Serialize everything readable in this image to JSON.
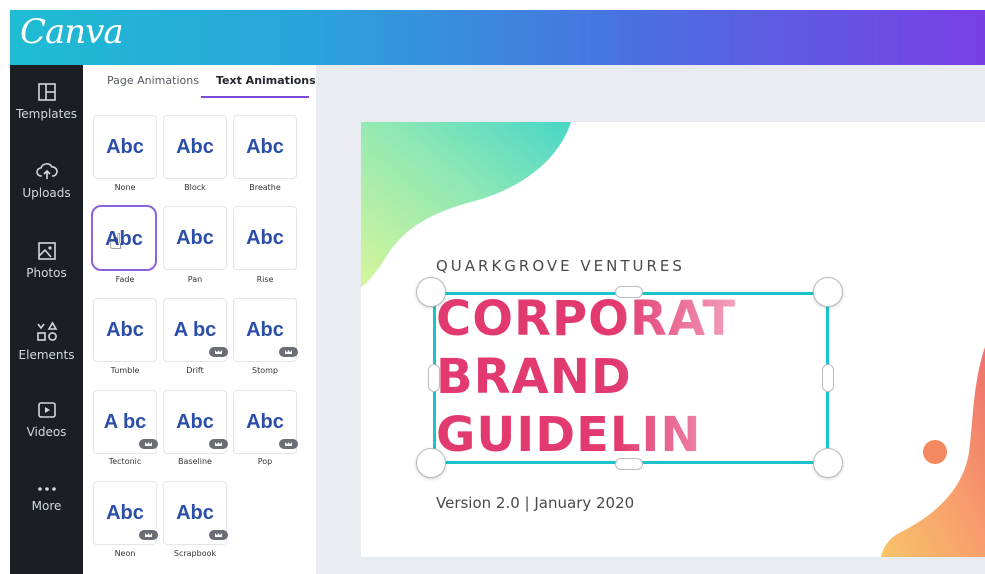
{
  "app": {
    "logo": "Canva"
  },
  "rail": {
    "items": [
      {
        "label": "Templates",
        "icon": "templates-icon"
      },
      {
        "label": "Uploads",
        "icon": "upload-cloud-icon"
      },
      {
        "label": "Photos",
        "icon": "photo-icon"
      },
      {
        "label": "Elements",
        "icon": "shapes-icon"
      },
      {
        "label": "Videos",
        "icon": "video-play-icon"
      },
      {
        "label": "More",
        "icon": "more-dots-icon"
      }
    ]
  },
  "panel": {
    "tabs": [
      {
        "label": "Page Animations",
        "active": false
      },
      {
        "label": "Text Animations",
        "active": true
      }
    ],
    "tiles": [
      {
        "preview": "Abc",
        "name": "None",
        "premium": false,
        "selected": false
      },
      {
        "preview": "Abc",
        "name": "Block",
        "premium": false,
        "selected": false
      },
      {
        "preview": "Abc",
        "name": "Breathe",
        "premium": false,
        "selected": false
      },
      {
        "preview": "Abc",
        "name": "Fade",
        "premium": false,
        "selected": true
      },
      {
        "preview": "Abc",
        "name": "Pan",
        "premium": false,
        "selected": false
      },
      {
        "preview": "Abc",
        "name": "Rise",
        "premium": false,
        "selected": false
      },
      {
        "preview": "Abc",
        "name": "Tumble",
        "premium": false,
        "selected": false
      },
      {
        "preview": "A bc",
        "name": "Drift",
        "premium": true,
        "selected": false
      },
      {
        "preview": "Abc",
        "name": "Stomp",
        "premium": true,
        "selected": false
      },
      {
        "preview": "A bc",
        "name": "Tectonic",
        "premium": true,
        "selected": false
      },
      {
        "preview": "Abc",
        "name": "Baseline",
        "premium": true,
        "selected": false
      },
      {
        "preview": "Abc",
        "name": "Pop",
        "premium": true,
        "selected": false
      },
      {
        "preview": "Abc",
        "name": "Neon",
        "premium": true,
        "selected": false
      },
      {
        "preview": "Abc",
        "name": "Scrapbook",
        "premium": true,
        "selected": false
      }
    ]
  },
  "canvas": {
    "company": "QUARKGROVE VENTURES",
    "headline": [
      "CORPORAT",
      "BRAND",
      "GUIDELIN"
    ],
    "version": "Version 2.0 | January 2020"
  },
  "colors": {
    "selection": "#1bc3cf",
    "headline": "#e23a6e",
    "tab_accent": "#7d4bd7",
    "tile_text": "#2b4ea8"
  }
}
